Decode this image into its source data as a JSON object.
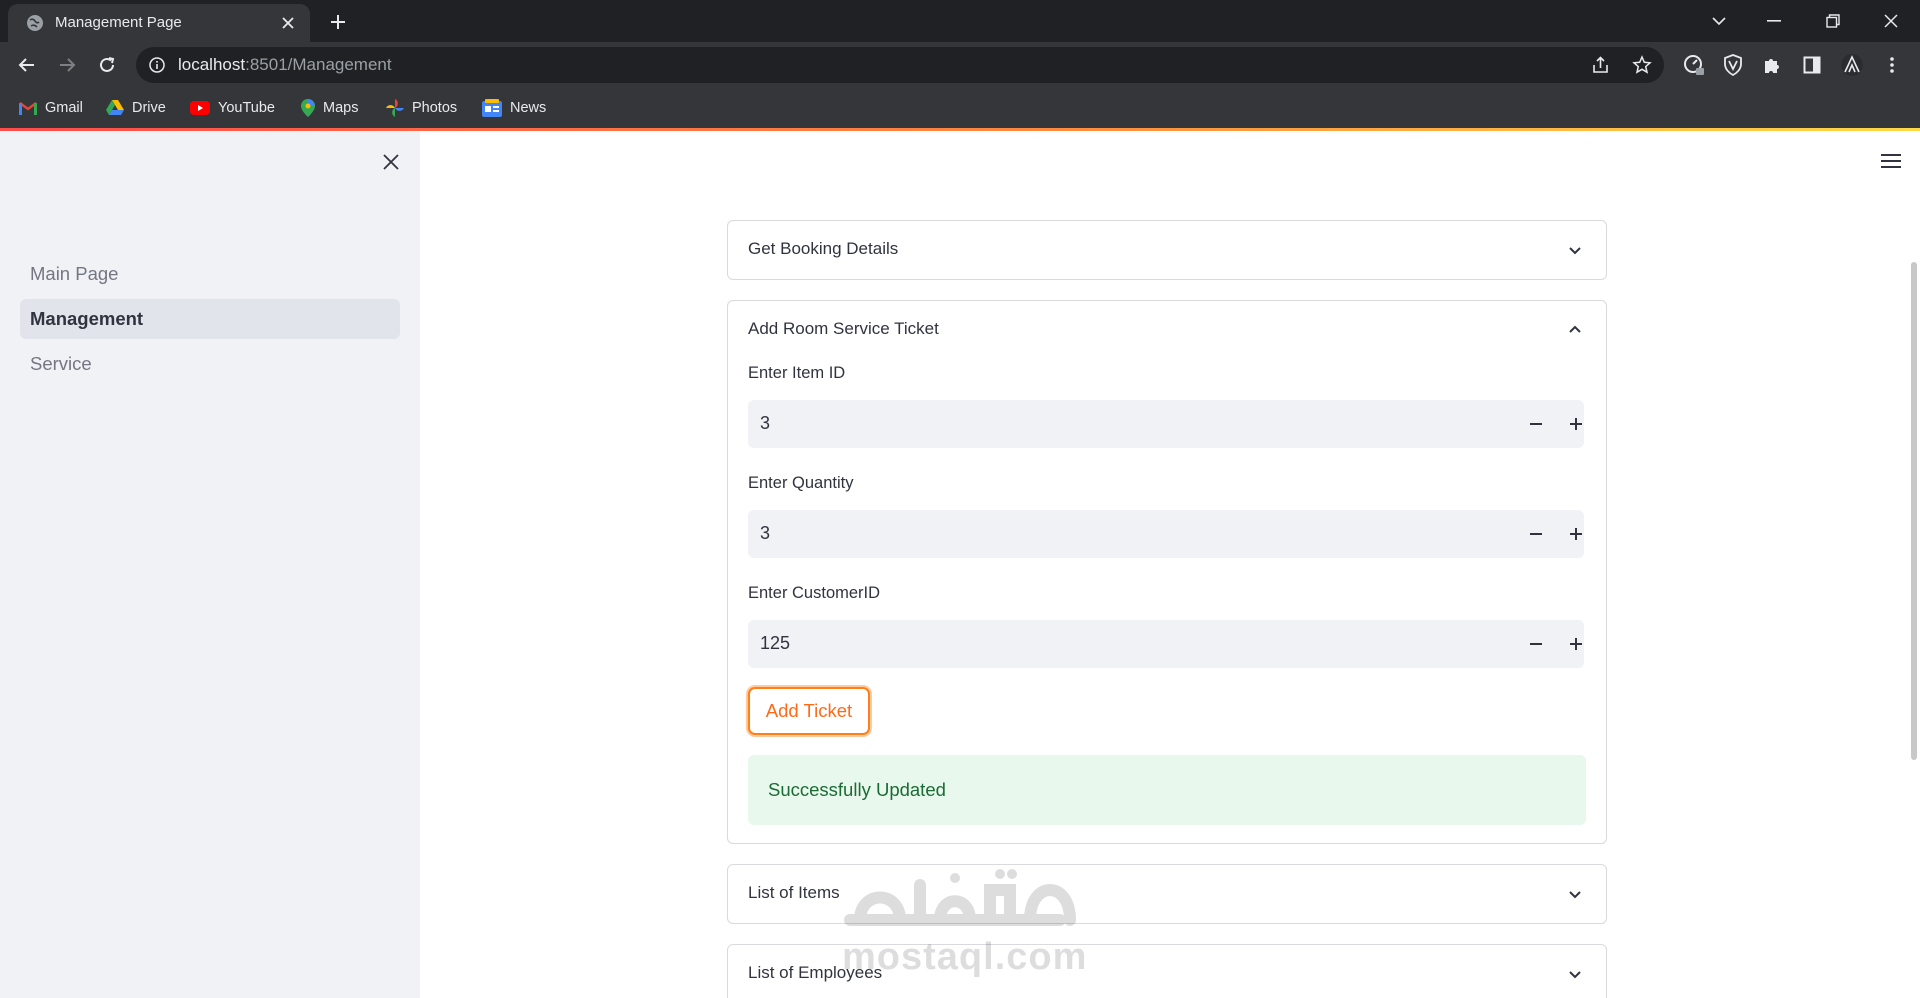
{
  "browser": {
    "tab_title": "Management Page",
    "url_host": "localhost",
    "url_rest": ":8501/Management",
    "bookmarks": [
      {
        "label": "Gmail",
        "icon": "gmail-icon"
      },
      {
        "label": "Drive",
        "icon": "drive-icon"
      },
      {
        "label": "YouTube",
        "icon": "youtube-icon"
      },
      {
        "label": "Maps",
        "icon": "maps-icon"
      },
      {
        "label": "Photos",
        "icon": "photos-icon"
      },
      {
        "label": "News",
        "icon": "news-icon"
      }
    ]
  },
  "sidebar": {
    "items": [
      {
        "label": "Main Page",
        "active": false
      },
      {
        "label": "Management",
        "active": true
      },
      {
        "label": "Service",
        "active": false
      }
    ]
  },
  "main": {
    "expanders": [
      {
        "title": "Get Booking Details",
        "expanded": false
      },
      {
        "title": "Add Room Service Ticket",
        "expanded": true
      },
      {
        "title": "List of Items",
        "expanded": false
      },
      {
        "title": "List of Employees",
        "expanded": false
      }
    ],
    "form": {
      "item_id_label": "Enter Item ID",
      "item_id_value": "3",
      "quantity_label": "Enter Quantity",
      "quantity_value": "3",
      "customer_label": "Enter CustomerID",
      "customer_value": "125",
      "submit_label": "Add Ticket"
    },
    "success_message": "Successfully Updated"
  },
  "watermark": {
    "arabic": "مستقل",
    "latin": "mostaql.com"
  },
  "colors": {
    "accent": "#ff6a1a",
    "success_bg": "#e8f8ec",
    "success_text": "#1b6b35",
    "sidebar_bg": "#f0f2f6"
  }
}
